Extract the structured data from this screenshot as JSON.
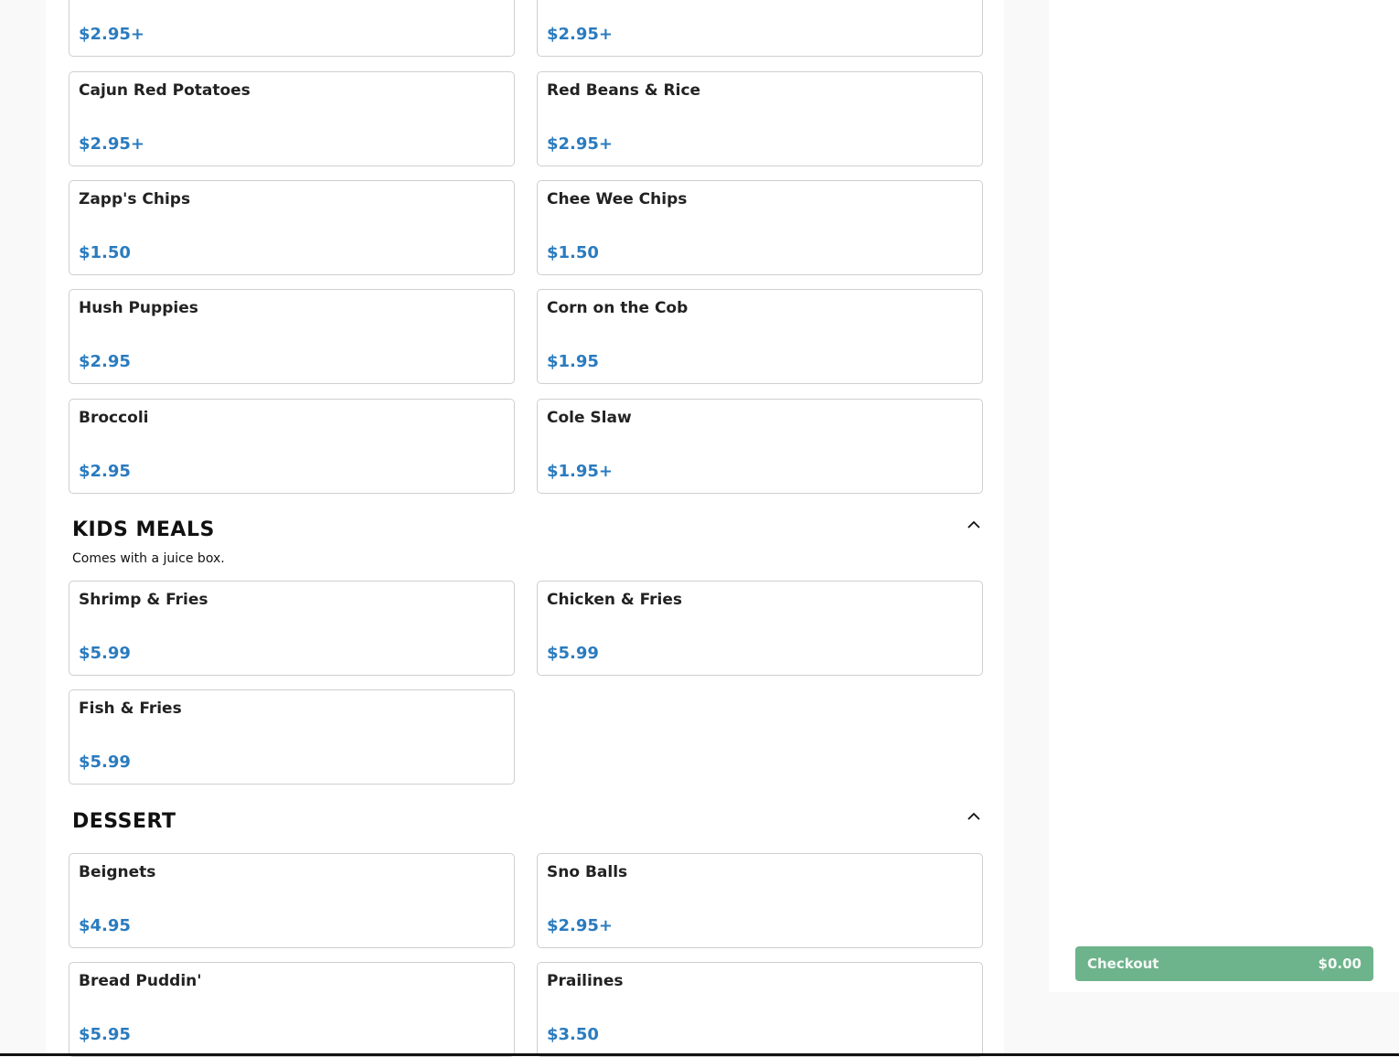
{
  "top_row": [
    {
      "price": "$2.95+"
    },
    {
      "price": "$2.95+"
    }
  ],
  "sides": [
    {
      "name": "Cajun Red Potatoes",
      "price": "$2.95+"
    },
    {
      "name": "Red Beans & Rice",
      "price": "$2.95+"
    },
    {
      "name": "Zapp's Chips",
      "price": "$1.50"
    },
    {
      "name": "Chee Wee Chips",
      "price": "$1.50"
    },
    {
      "name": "Hush Puppies",
      "price": "$2.95"
    },
    {
      "name": "Corn on the Cob",
      "price": "$1.95"
    },
    {
      "name": "Broccoli",
      "price": "$2.95"
    },
    {
      "name": "Cole Slaw",
      "price": "$1.95+"
    }
  ],
  "kids_meals": {
    "title": "KIDS MEALS",
    "description": "Comes with a juice box.",
    "collapse_icon": "chevron-up-icon",
    "items": [
      {
        "name": "Shrimp & Fries",
        "price": "$5.99"
      },
      {
        "name": "Chicken & Fries",
        "price": "$5.99"
      },
      {
        "name": "Fish & Fries",
        "price": "$5.99"
      }
    ]
  },
  "dessert": {
    "title": "DESSERT",
    "collapse_icon": "chevron-up-icon",
    "items": [
      {
        "name": "Beignets",
        "price": "$4.95"
      },
      {
        "name": "Sno Balls",
        "price": "$2.95+"
      },
      {
        "name": "Bread Puddin'",
        "price": "$5.95"
      },
      {
        "name": "Prailines",
        "price": "$3.50"
      }
    ]
  },
  "checkout": {
    "label": "Checkout",
    "amount": "$0.00"
  },
  "colors": {
    "price": "#2a7bbf",
    "checkout_bg": "#6db38b",
    "card_border": "#cfcfcf"
  }
}
